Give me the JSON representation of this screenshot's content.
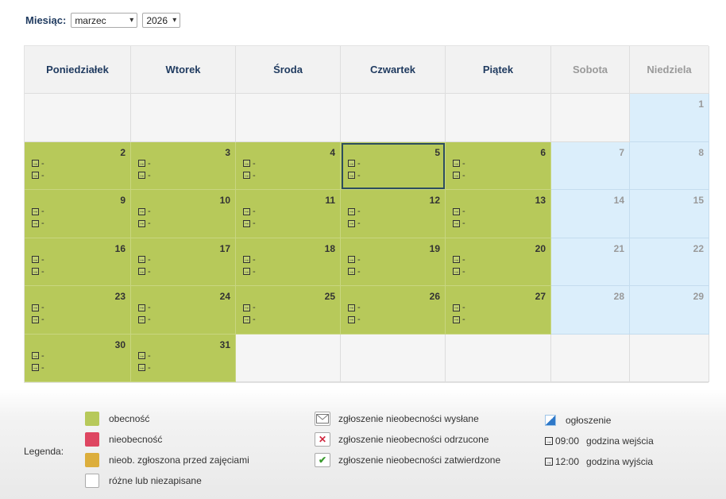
{
  "filter": {
    "month_label": "Miesiąc:",
    "month_value": "marzec",
    "year_value": "2026"
  },
  "weekdays": [
    "Poniedziałek",
    "Wtorek",
    "Środa",
    "Czwartek",
    "Piątek",
    "Sobota",
    "Niedziela"
  ],
  "cell_placeholder": "-",
  "days": [
    [
      "",
      "",
      "",
      "",
      "",
      "",
      "1"
    ],
    [
      "2",
      "3",
      "4",
      "5",
      "6",
      "7",
      "8"
    ],
    [
      "9",
      "10",
      "11",
      "12",
      "13",
      "14",
      "15"
    ],
    [
      "16",
      "17",
      "18",
      "19",
      "20",
      "21",
      "22"
    ],
    [
      "23",
      "24",
      "25",
      "26",
      "27",
      "28",
      "29"
    ],
    [
      "30",
      "31",
      "",
      "",
      "",
      "",
      ""
    ]
  ],
  "selected_day": "5",
  "legend": {
    "title": "Legenda:",
    "status": [
      {
        "label": "obecność",
        "color": "#b7c95a"
      },
      {
        "label": "nieobecność",
        "color": "#de4661"
      },
      {
        "label": "nieob. zgłoszona przed zajęciami",
        "color": "#dcae3c"
      },
      {
        "label": "różne lub niezapisane",
        "color": "#ffffff"
      }
    ],
    "requests": [
      {
        "label": "zgłoszenie nieobecności wysłane",
        "icon": "envelope-icon"
      },
      {
        "label": "zgłoszenie nieobecności odrzucone",
        "icon": "reject-x-icon"
      },
      {
        "label": "zgłoszenie nieobecności zatwierdzone",
        "icon": "approve-check-icon"
      }
    ],
    "announcement": "ogłoszenie",
    "entry_time": "09:00",
    "entry_label": "godzina wejścia",
    "exit_time": "12:00",
    "exit_label": "godzina wyjścia"
  }
}
